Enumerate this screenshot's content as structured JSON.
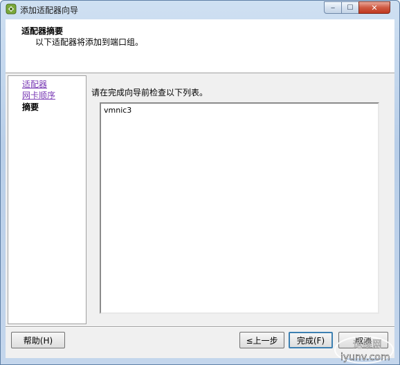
{
  "window": {
    "title": "添加适配器向导",
    "min_glyph": "‒",
    "max_glyph": "☐",
    "close_glyph": "✕"
  },
  "header": {
    "title": "适配器摘要",
    "subtitle": "以下适配器将添加到端口组。"
  },
  "nav": {
    "items": [
      {
        "label": "适配器",
        "state": "link"
      },
      {
        "label": "网卡顺序",
        "state": "link"
      },
      {
        "label": "摘要",
        "state": "current"
      }
    ]
  },
  "main": {
    "instruction": "请在完成向导前检查以下列表。",
    "list": [
      "vmnic3"
    ]
  },
  "footer": {
    "help_label": "帮助(H)",
    "back_label": "≤上一步",
    "finish_label": "完成(F)",
    "cancel_label": "取消"
  },
  "watermark": {
    "text1": "运维网",
    "text2": "iyunv.com"
  },
  "colors": {
    "link": "#7a3bb5",
    "title_bar": "#c4d6ec",
    "close_button": "#c0381f",
    "default_button_border": "#3c7fb1"
  }
}
